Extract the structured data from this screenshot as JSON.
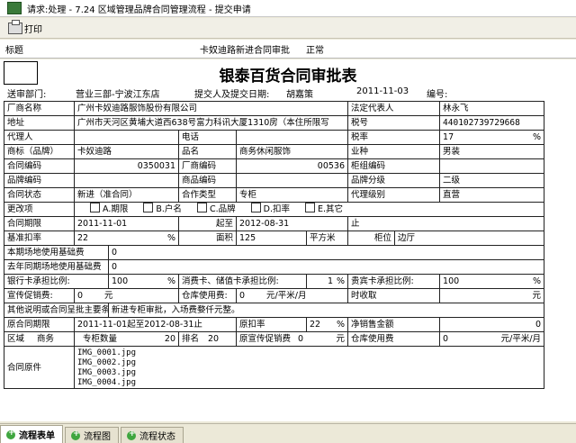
{
  "window": {
    "title": "请求:处理 - 7.24 区域管理品牌合同管理流程 - 提交申请"
  },
  "toolbar": {
    "print_label": "打印"
  },
  "header": {
    "title_label": "标题",
    "subject": "卡奴迪路新进合同审批",
    "status": "正常"
  },
  "form": {
    "title": "银泰百货合同审批表",
    "info": {
      "dept_label": "送审部门:",
      "dept": "营业三部-宁波江东店",
      "submitter_label": "提交人及提交日期:",
      "submitter": "胡嘉策",
      "date": "2011-11-03",
      "code_label": "编号:"
    },
    "labels": {
      "vendor": "厂商名称",
      "legal_rep": "法定代表人",
      "address": "地址",
      "tax_no": "税号",
      "agent": "代理人",
      "phone": "电话",
      "tax_rate": "税率",
      "brand": "商标（品牌）",
      "product_name": "品名",
      "business_type": "业种",
      "contract_code": "合同编码",
      "vendor_code": "厂商编码",
      "counter_code": "柜组编码",
      "brand_code": "品牌编码",
      "product_code": "商品编码",
      "brand_grade": "品牌分级",
      "contract_status": "合同状态",
      "coop_type": "合作类型",
      "agent_level": "代理级别",
      "changes": "更改项",
      "period": "合同期限",
      "start": "起至",
      "base_rate": "基准扣率",
      "area": "面积",
      "area_unit": "平方米",
      "position": "柜位",
      "base_fee": "本期场地使用基础费",
      "last_base_fee": "去年同期场地使用基础费",
      "bank_card": "银行卡承担比例:",
      "consume_card": "消费卡、储值卡承担比例:",
      "vip_card": "贵宾卡承担比例:",
      "promo_fee": "宣传促销费:",
      "storage_fee": "仓库使用费:",
      "time_fee": "时收取",
      "other": "其他说明或合同呈批主要条款",
      "orig_period": "原合同期限",
      "orig_rate": "原扣率",
      "net_sales": "净销售金额",
      "region": "区域",
      "business": "商务",
      "counter_qty": "专柜数量",
      "rank": "排名",
      "orig_promo": "原宣传促销费",
      "storage_use": "仓库使用费",
      "orig_attach": "合同原件"
    },
    "values": {
      "vendor": "广州卡奴迪路服饰股份有限公司",
      "legal_rep": "林永飞",
      "address": "广州市天河区黄埔大道西638号富力科讯大厦1310房（本住所限写",
      "tax_no": "440102739729668",
      "tax_rate": "17",
      "pct": "%",
      "brand": "卡奴迪路",
      "product": "商务休闲服饰",
      "business_type": "男装",
      "contract_code": "0350031",
      "vendor_code": "00536",
      "brand_grade": "二级",
      "contract_status": "新进（准合同）",
      "coop_type": "专柜",
      "agent_level": "直营",
      "change_options": [
        "A.期限",
        "B.户名",
        "C.品牌",
        "D.扣率",
        "E.其它"
      ],
      "period_start": "2011-11-01",
      "period_end": "2012-08-31",
      "end_suffix": "止",
      "base_rate": "22",
      "area": "125",
      "position": "边厅",
      "base_fee": "0",
      "last_base_fee": "0",
      "bank_card": "100",
      "consume_card": "1",
      "vip_card": "100",
      "promo_fee": "0",
      "yuan": "元",
      "storage_fee": "0",
      "storage_unit": "元/平米/月",
      "yuan_end": "元",
      "other": "新进专柜审批，入场费婺仟元整。",
      "orig_period": "2011-11-01起至2012-08-31止",
      "orig_rate": "22",
      "net_sales": "0",
      "counter_qty": "20",
      "rank": "20",
      "orig_promo": "0",
      "storage_use": "0",
      "files": [
        "IMG_0001.jpg",
        "IMG_0002.jpg",
        "IMG_0003.jpg",
        "IMG_0004.jpg"
      ]
    }
  },
  "tabs": [
    {
      "label": "流程表单"
    },
    {
      "label": "流程图"
    },
    {
      "label": "流程状态"
    }
  ]
}
